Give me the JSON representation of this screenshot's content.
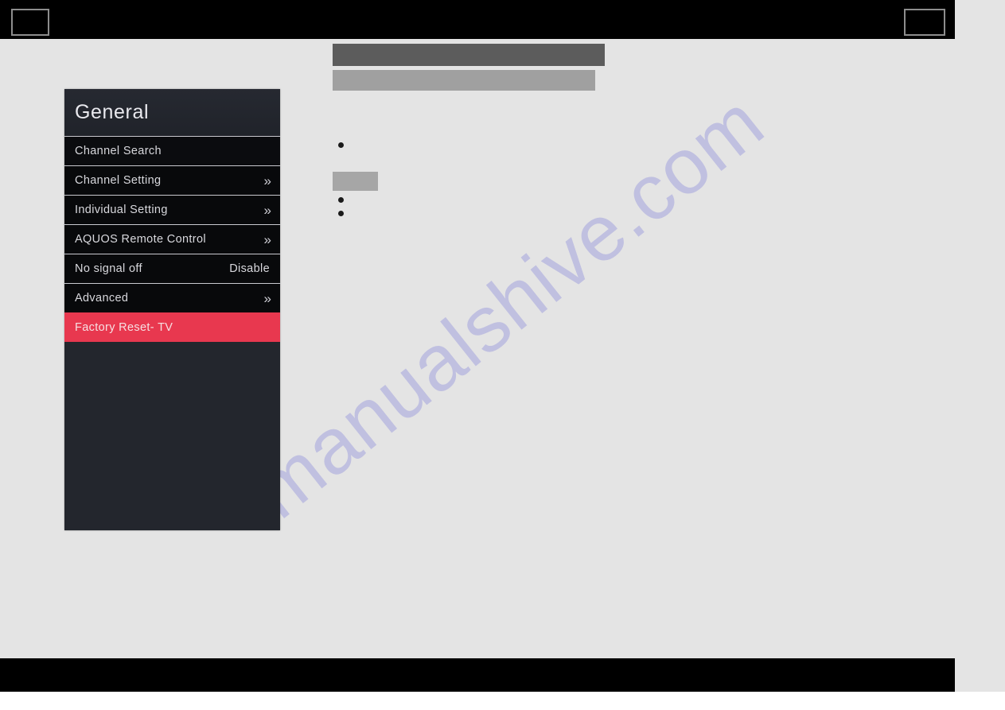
{
  "page": {
    "background_color": "#e4e4e4",
    "band_color": "#000000"
  },
  "header": {
    "left_box_label": "",
    "right_box_label": ""
  },
  "footer": {
    "label": ""
  },
  "watermark": {
    "text": "manualshive.com",
    "color": "#bcbce0"
  },
  "document_body": {
    "redacted_bars": [
      {
        "name": "heading-bar",
        "color": "#5c5c5c"
      },
      {
        "name": "subheading-bar",
        "color": "#a0a0a0"
      },
      {
        "name": "inline-bar",
        "color": "#a6a6a6"
      }
    ],
    "bullets": [
      "",
      "",
      ""
    ]
  },
  "tv_menu": {
    "title": "General",
    "accent_color": "#e8384f",
    "panel_color": "#23262d",
    "items": [
      {
        "label": "Channel Search",
        "value": "",
        "chevron": ""
      },
      {
        "label": "Channel Setting",
        "value": "",
        "chevron": "»"
      },
      {
        "label": "Individual Setting",
        "value": "",
        "chevron": "»"
      },
      {
        "label": "AQUOS Remote Control",
        "value": "",
        "chevron": "»"
      },
      {
        "label": "No signal off",
        "value": "Disable",
        "chevron": ""
      },
      {
        "label": "Advanced",
        "value": "",
        "chevron": "»"
      },
      {
        "label": "Factory Reset- TV",
        "value": "",
        "chevron": ""
      }
    ],
    "selected_index": 6
  }
}
